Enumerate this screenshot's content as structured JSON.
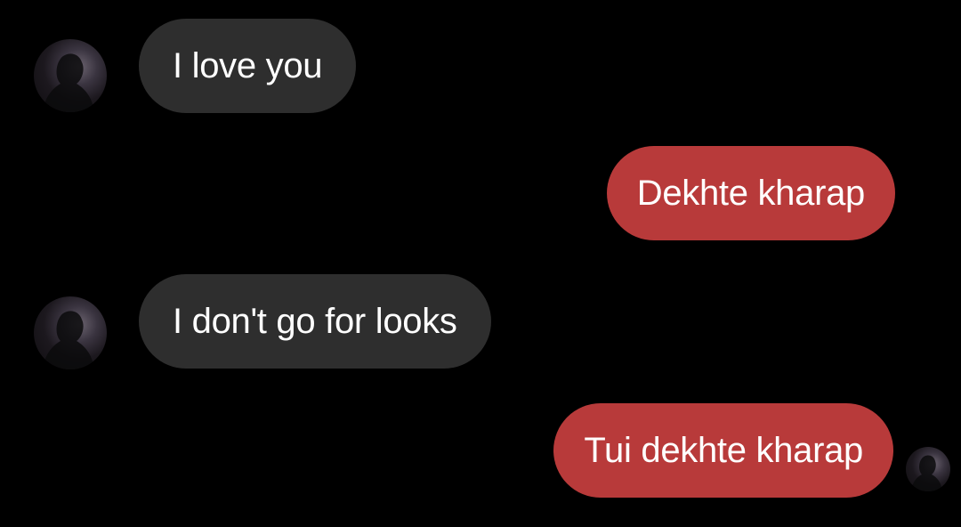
{
  "conversation": {
    "messages": [
      {
        "direction": "incoming",
        "text": "I love you"
      },
      {
        "direction": "outgoing",
        "text": "Dekhte kharap"
      },
      {
        "direction": "incoming",
        "text": "I don't go for looks"
      },
      {
        "direction": "outgoing",
        "text": "Tui dekhte kharap"
      }
    ],
    "avatar_icon": "user-avatar-icon",
    "read_receipt_icon": "seen-avatar-icon"
  },
  "colors": {
    "background": "#000000",
    "incoming_bubble": "#2e2e2e",
    "outgoing_bubble": "#b83a3a",
    "text": "#ffffff"
  }
}
